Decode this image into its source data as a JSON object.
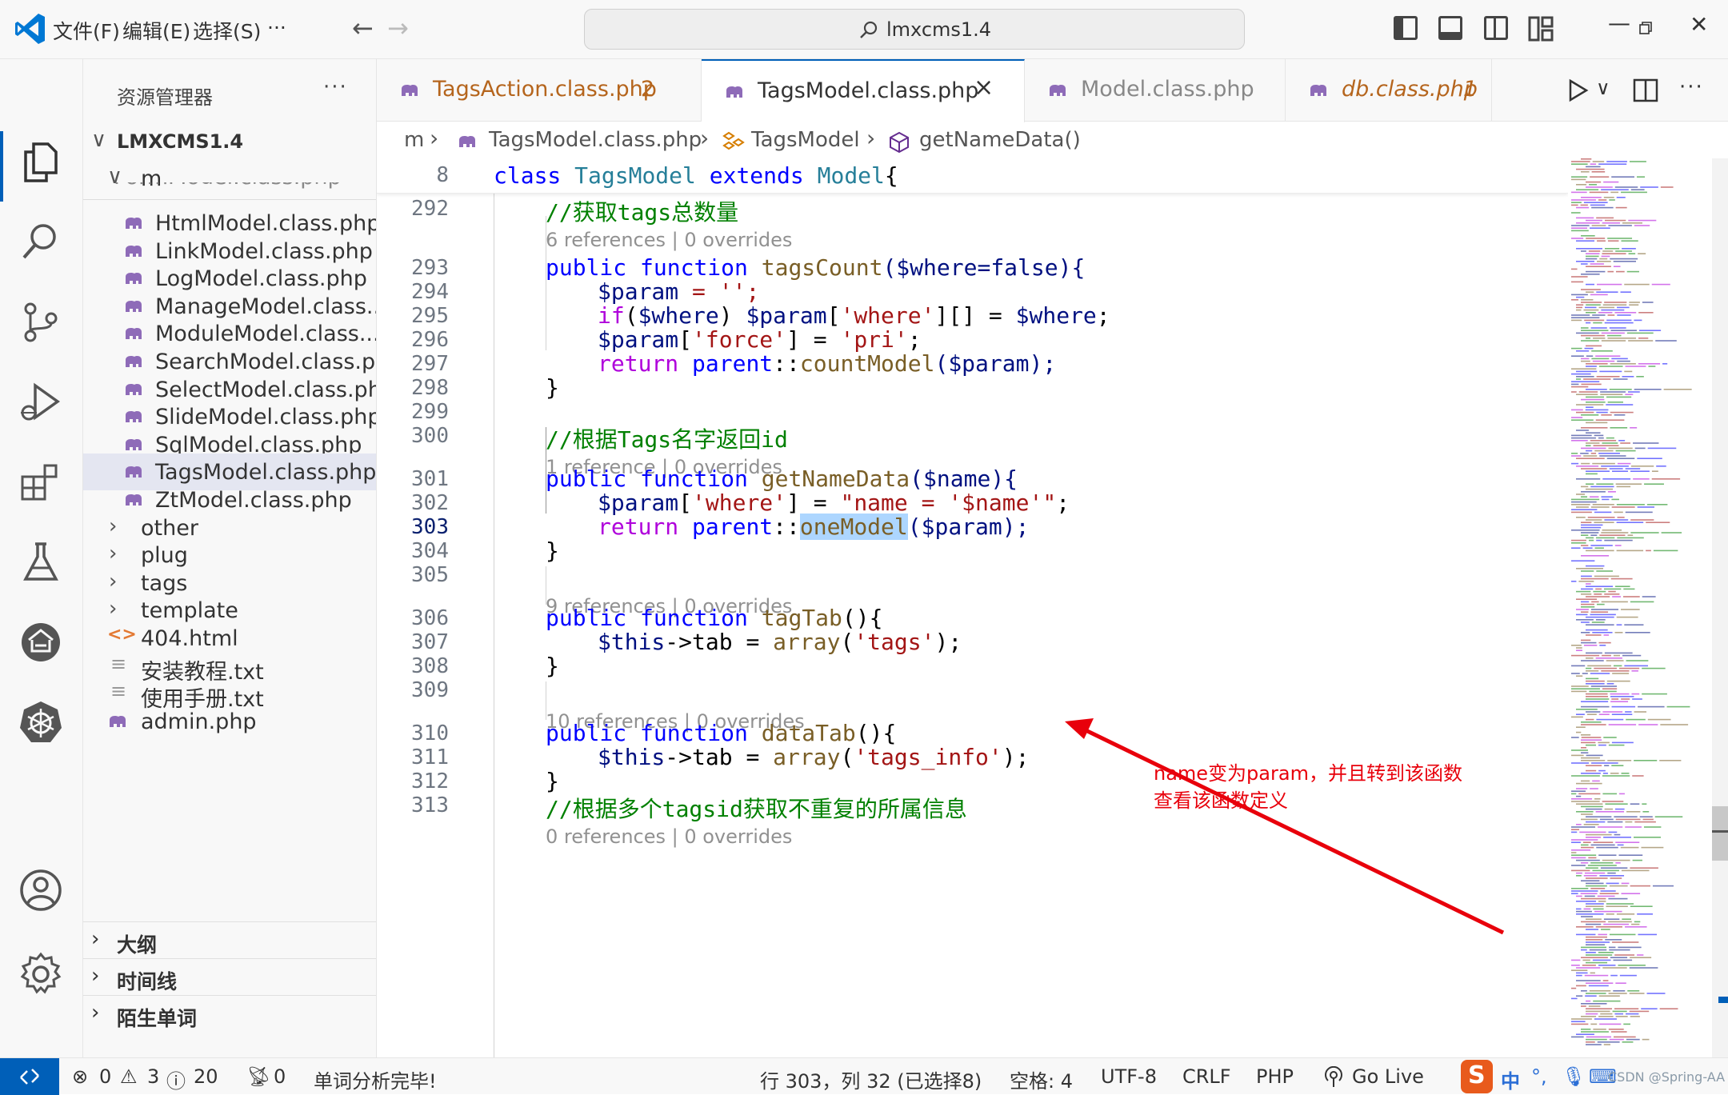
{
  "titlebar": {
    "menus": [
      "文件(F)",
      "编辑(E)",
      "选择(S)",
      "···"
    ],
    "search_text": "lmxcms1.4"
  },
  "sidebar": {
    "title": "资源管理器",
    "more": "···",
    "root": "LMXCMS1.4",
    "folder_m": "m",
    "cut_off_file": "FormModel.class.php",
    "files": [
      "HtmlModel.class.php",
      "LinkModel.class.php",
      "LogModel.class.php",
      "ManageModel.class....",
      "ModuleModel.class....",
      "SearchModel.class.p...",
      "SelectModel.class.php",
      "SlideModel.class.php",
      "SqlModel.class.php",
      "TagsModel.class.php",
      "ZtModel.class.php"
    ],
    "folders": [
      "other",
      "plug",
      "tags",
      "template"
    ],
    "root_files": [
      "404.html",
      "安装教程.txt",
      "使用手册.txt",
      "admin.php"
    ],
    "panels": [
      "大纲",
      "时间线",
      "陌生单词"
    ]
  },
  "tabs": [
    {
      "label": "TagsAction.class.php",
      "badge": "2"
    },
    {
      "label": "TagsModel.class.php",
      "close": "×"
    },
    {
      "label": "Model.class.php"
    },
    {
      "label": "db.class.php",
      "badge": "1"
    }
  ],
  "breadcrumb": {
    "parts": [
      "m",
      "TagsModel.class.php",
      "TagsModel",
      "getNameData()"
    ],
    "sep": "›"
  },
  "editor": {
    "sticky_line": "8",
    "line_numbers": [
      "292",
      "293",
      "294",
      "295",
      "296",
      "297",
      "298",
      "299",
      "300",
      "301",
      "302",
      "303",
      "304",
      "305",
      "306",
      "307",
      "308",
      "309",
      "310",
      "311",
      "312",
      "313"
    ],
    "lens": [
      "6 references | 0 overrides",
      "1 reference | 0 overrides",
      "9 references | 0 overrides",
      "10 references | 0 overrides",
      "0 references | 0 overrides"
    ],
    "tokens": {
      "class_kw": "class",
      "class_name": "TagsModel",
      "extends_kw": "extends",
      "parent_class": "Model",
      "brace_open": "{",
      "cm_total": "//获取tags总数量",
      "cm_id": "//根据Tags名字返回id",
      "cm_multi": "//根据多个tagsid获取不重复的所属信息",
      "public": "public",
      "function": "function",
      "fn_count": "tagsCount",
      "fn_getname": "getNameData",
      "fn_tagtab": "tagTab",
      "fn_datatab": "dataTab",
      "params_count": "($where=false){",
      "params_name": "($name){",
      "params_empty": "(){",
      "var_param": "$param",
      "var_where": "$where",
      "var_this": "$this",
      "assign_empty": " = '';",
      "if_kw": "if",
      "where_key": "'where'",
      "force_key": "'force'",
      "pri_val": "'pri'",
      "name_val": "\"name = '$name'\"",
      "return_kw": "return",
      "parent_kw": "parent",
      "dcolon": "::",
      "countModel": "countModel",
      "oneModel": "oneModel",
      "call_param_end": "($param);",
      "brace_close": "}",
      "tab_prop": "->tab = ",
      "array_fn": "array",
      "tags_str": "'tags'",
      "tags_info_str": "'tags_info'",
      "array_end": ");"
    }
  },
  "annotation": {
    "line1": "name变为param，并且转到该函数",
    "line2": "查看该函数定义"
  },
  "statusbar": {
    "errors": "0",
    "warnings": "3",
    "infos": "20",
    "ports": "0",
    "message": "单词分析完毕!",
    "position": "行 303，列 32 (已选择8)",
    "spaces": "空格: 4",
    "encoding": "UTF-8",
    "eol": "CRLF",
    "language": "PHP",
    "golive": "Go Live",
    "ime": "中",
    "watermark": "CSDN @Spring-AA"
  },
  "colors": {
    "accent": "#005fb8",
    "keyword": "#0000ff",
    "comment": "#008000",
    "string": "#a31515",
    "annotation": "#e8000b",
    "php_icon": "#8e6bb8"
  },
  "icons": [
    "vscode-logo-icon",
    "explorer-icon",
    "search-icon",
    "source-control-icon",
    "run-debug-icon",
    "extensions-icon",
    "testing-icon",
    "remote-icon",
    "kubernetes-icon",
    "account-icon",
    "settings-gear-icon"
  ]
}
